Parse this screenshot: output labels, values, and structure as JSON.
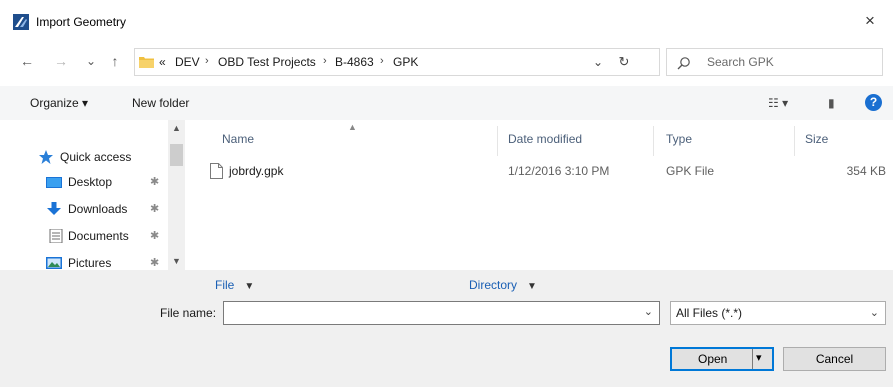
{
  "window": {
    "title": "Import Geometry",
    "close_glyph": "×"
  },
  "nav": {
    "back_glyph": "←",
    "forward_glyph": "→",
    "recent_glyph": "⌄",
    "up_glyph": "↑"
  },
  "address": {
    "overflow": "«",
    "crumbs": [
      "DEV",
      "OBD Test Projects",
      "B-4863",
      "GPK"
    ],
    "separator": "›",
    "dropdown_glyph": "⌄",
    "refresh_glyph": "↻"
  },
  "search": {
    "placeholder": "Search GPK"
  },
  "toolbar": {
    "organize": "Organize ▾",
    "new_folder": "New folder",
    "view_glyph": "☷ ▾",
    "pane_glyph": "▮",
    "help": "?"
  },
  "sidebar": {
    "items": [
      {
        "label": "Quick access",
        "icon": "star-icon"
      },
      {
        "label": "Desktop",
        "icon": "desktop-icon",
        "pinned": true
      },
      {
        "label": "Downloads",
        "icon": "downloads-icon",
        "pinned": true
      },
      {
        "label": "Documents",
        "icon": "documents-icon",
        "pinned": true
      },
      {
        "label": "Pictures",
        "icon": "pictures-icon",
        "pinned": true
      }
    ],
    "pin_glyph": "✱"
  },
  "columns": {
    "name": "Name",
    "date": "Date modified",
    "type": "Type",
    "size": "Size"
  },
  "files": [
    {
      "name": "jobrdy.gpk",
      "date": "1/12/2016 3:10 PM",
      "type": "GPK File",
      "size": "354 KB"
    }
  ],
  "bottom": {
    "file_link": "File",
    "directory_link": "Directory",
    "dropdown_caret": "▼",
    "file_name_label": "File name:",
    "file_name_value": "",
    "filter_value": "All Files (*.*)",
    "open_label": "Open",
    "cancel_label": "Cancel"
  },
  "colors": {
    "accent": "#0078d7",
    "link": "#1a5fb4",
    "help": "#1a6fd1",
    "header_text": "#4c607a"
  }
}
